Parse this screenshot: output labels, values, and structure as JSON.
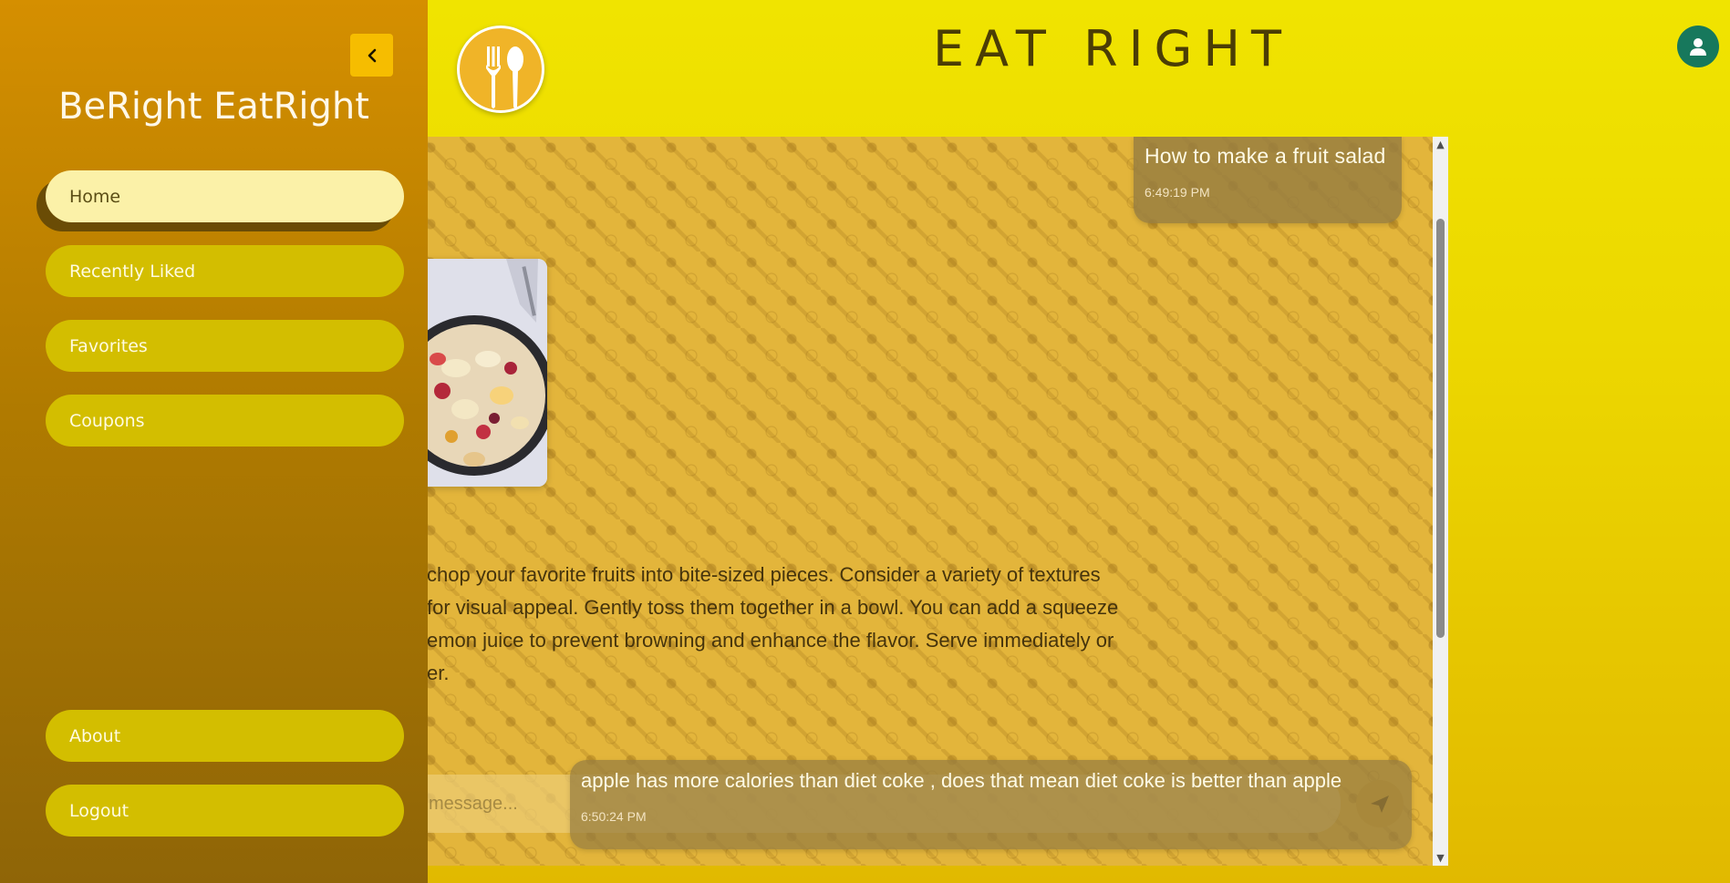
{
  "header": {
    "title": "EAT RIGHT",
    "logo_icon": "fork-spoon-icon",
    "profile_icon": "user-icon"
  },
  "sidebar": {
    "brand": "BeRight EatRight",
    "collapse_icon": "chevron-left-icon",
    "items": [
      {
        "label": "Home",
        "active": true
      },
      {
        "label": "Recently Liked",
        "active": false
      },
      {
        "label": "Favorites",
        "active": false
      },
      {
        "label": "Coupons",
        "active": false
      }
    ],
    "bottom_items": [
      {
        "label": "About"
      },
      {
        "label": "Logout"
      }
    ]
  },
  "chat": {
    "messages": [
      {
        "text": "How to make a fruit salad",
        "time": "6:49:19 PM"
      },
      {
        "text": "apple has more calories than diet coke , does that mean diet coke is better than apple",
        "time": "6:50:24 PM"
      }
    ],
    "reply_lines": [
      "chop your favorite fruits into bite-sized pieces. Consider a variety of textures",
      "for visual appeal. Gently toss them together in a bowl. You can add a squeeze",
      "emon juice to prevent browning and enhance the flavor. Serve immediately or",
      "er."
    ],
    "input_placeholder": "message...",
    "send_icon": "send-icon"
  },
  "colors": {
    "sidebar_top": "#d58f00",
    "sidebar_bottom": "#8f6507",
    "nav_button": "#d3be00",
    "nav_active": "#fbf1a8",
    "chat_bg": "#e3b53b",
    "profile": "#17785c"
  }
}
